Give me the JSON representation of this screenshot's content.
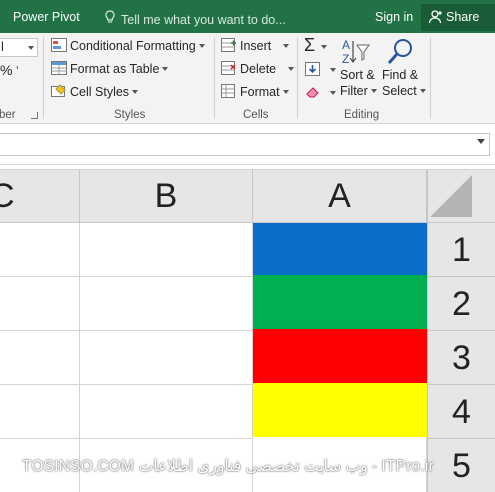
{
  "topbar": {
    "power_pivot": "Power Pivot",
    "tell_me": "Tell me what you want to do...",
    "sign_in": "Sign in",
    "share": "Share"
  },
  "ribbon": {
    "font_size_value": "l",
    "percent": "%",
    "styles": {
      "conditional_formatting": "Conditional Formatting",
      "format_as_table": "Format as Table",
      "cell_styles": "Cell Styles",
      "group_label": "Styles"
    },
    "cells": {
      "insert": "Insert",
      "delete": "Delete",
      "format": "Format",
      "group_label": "Cells"
    },
    "editing": {
      "sort_filter_1": "Sort &",
      "sort_filter_2": "Filter",
      "find_select_1": "Find &",
      "find_select_2": "Select",
      "group_label": "Editing"
    },
    "number_group_label_fragment": "ber"
  },
  "columns": [
    "C",
    "B",
    "A"
  ],
  "rows": [
    "1",
    "2",
    "3",
    "4",
    "5"
  ],
  "cell_colors": {
    "A1": "#0A6EC6",
    "A2": "#00AF50",
    "A3": "#FF0000",
    "A4": "#FFFF00"
  },
  "colors": {
    "title_bar": "#217346",
    "ribbon_bg": "#f3f3f3",
    "header_bg": "#e6e6e6"
  },
  "watermark": "TOSINSO.COM  وب سایت تخصصی فناوری اطلاعات - ITPro.ir"
}
